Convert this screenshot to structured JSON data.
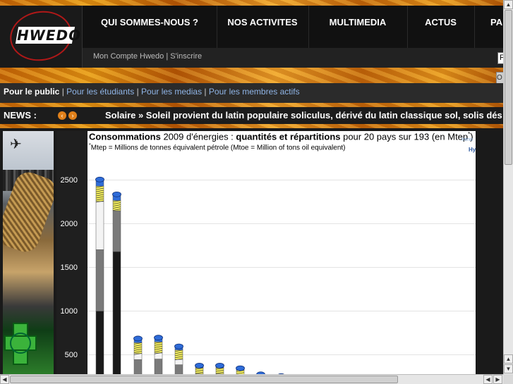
{
  "header": {
    "logo_text": "HWEDO",
    "nav": [
      "QUI SOMMES-NOUS ?",
      "NOS ACTIVITES",
      "MULTIMEDIA",
      "ACTUS",
      "PA"
    ],
    "account_links": "Mon Compte Hwedo | S'inscrire",
    "search_value": "F",
    "search_button": "O"
  },
  "audience": {
    "public": "Pour le public",
    "links": [
      "Pour les étudiants",
      "Pour les medias",
      "Pour les membres actifs"
    ],
    "separator": "|"
  },
  "news": {
    "label": "NEWS :",
    "prev_icon": "prev-arrow-icon",
    "next_icon": "next-arrow-icon",
    "headline": "Solaire » Soleil provient du latin populaire soliculus, dérivé du latin classique sol, solis dés"
  },
  "chart": {
    "title_bold_1": "Consommations",
    "title_1": " 2009 d'énergies : ",
    "title_bold_2": "quantités et répartitions",
    "title_2": " pour 20 pays sur 193 (en Mtep",
    "title_sup": "*",
    "title_end": ")",
    "subtitle_sup": "*",
    "subtitle": "Mtep = Millions de tonnes équivalent pétrole (Mtoe = Million of tons oil equivalent)",
    "legend_fragment_1": "Ireno",
    "legend_fragment_2": "Hy",
    "yticks": [
      "2500",
      "2000",
      "1500",
      "1000",
      "500"
    ]
  },
  "chart_data": {
    "type": "bar",
    "title": "Consommations 2009 d'énergies : quantités et répartitions pour 20 pays sur 193 (en Mtep*)",
    "ylabel": "",
    "ylim": [
      0,
      2700
    ],
    "yticks": [
      500,
      1000,
      1500,
      2000,
      2500
    ],
    "grid": true,
    "totals": [
      2510,
      2340,
      690,
      700,
      600,
      380,
      380,
      350,
      280,
      260,
      220,
      220,
      190
    ],
    "colors": {
      "oil": "#1a1a1a",
      "gas": "#7a7a7a",
      "coal": "#f4f4f4",
      "nuclear": "#f1ec5a",
      "hydro": "#2f6cd8"
    }
  },
  "scrollbars": {
    "up": "▲",
    "down": "▼",
    "left": "◀",
    "right": "▶"
  }
}
